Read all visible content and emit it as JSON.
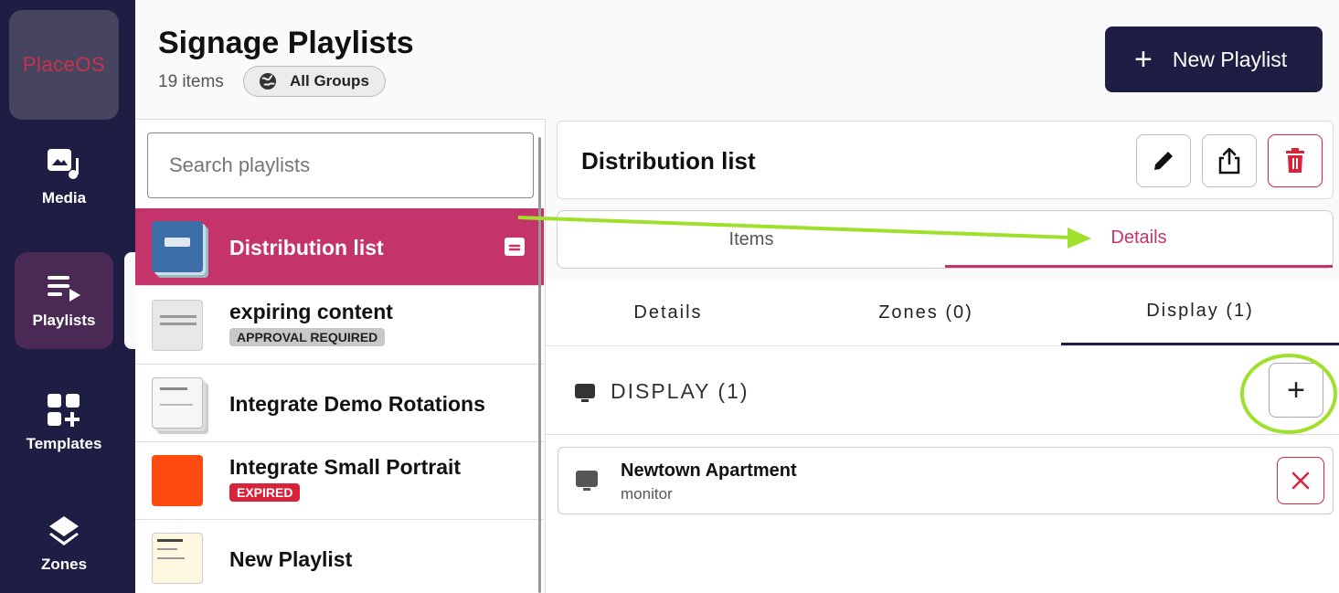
{
  "app": {
    "logo_text": "PlaceOS"
  },
  "nav": {
    "items": [
      {
        "label": "Media",
        "icon": "media-icon"
      },
      {
        "label": "Playlists",
        "icon": "playlist-icon",
        "active": true
      },
      {
        "label": "Templates",
        "icon": "templates-icon"
      },
      {
        "label": "Zones",
        "icon": "layers-icon"
      }
    ]
  },
  "header": {
    "title": "Signage Playlists",
    "count": "19 items",
    "groups_label": "All Groups",
    "new_button_label": "New Playlist"
  },
  "list": {
    "search_placeholder": "Search playlists",
    "items": [
      {
        "title": "Distribution list",
        "badge": "",
        "active": true
      },
      {
        "title": "expiring content",
        "badge": "APPROVAL REQUIRED"
      },
      {
        "title": "Integrate Demo Rotations",
        "badge": ""
      },
      {
        "title": "Integrate Small Portrait",
        "badge": "EXPIRED"
      },
      {
        "title": "New Playlist",
        "badge": ""
      }
    ]
  },
  "detail": {
    "title": "Distribution list",
    "tabs": [
      "Items",
      "Details"
    ],
    "active_tab": "Details",
    "subtabs": [
      "Details",
      "Zones (0)",
      "Display (1)"
    ],
    "active_subtab": "Display (1)",
    "section_title": "DISPLAY (1)",
    "displays": [
      {
        "name": "Newtown Apartment",
        "type": "monitor"
      }
    ]
  },
  "colors": {
    "nav_bg": "#1e1d43",
    "accent": "#c5336b",
    "danger": "#d9233a",
    "annotation": "#9ee02b"
  }
}
